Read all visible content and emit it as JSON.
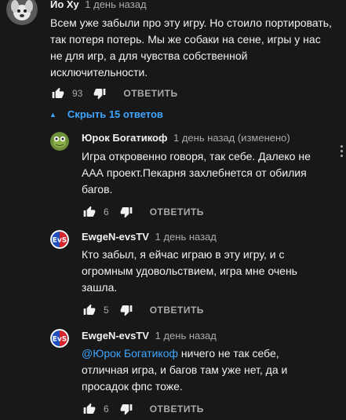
{
  "top_comment": {
    "author": "Йо Ху",
    "time": "1 день назад",
    "text": "Всем уже забыли про эту игру. Но стоило портировать, так потеря потерь. Мы же собаки на сене, игры у нас не для игр, а для чувства собственной исключительности.",
    "likes": "93",
    "reply_label": "ОТВЕТИТЬ",
    "avatar_icon": "dog-avatar-icon"
  },
  "replies_toggle": {
    "label": "Скрыть 15 ответов",
    "icon": "caret-up-icon"
  },
  "replies": [
    {
      "author": "Юрок Богатикоф",
      "time": "1 день назад (изменено)",
      "text": "Игра откровенно говоря, так себе. Далеко не ААА проект.Пекарня захлебнется от обилия багов.",
      "likes": "6",
      "reply_label": "ОТВЕТИТЬ",
      "avatar_icon": "frog-avatar-icon"
    },
    {
      "author": "EwgeN-evsTV",
      "time": "1 день назад",
      "text": "Кто забыл, я ейчас играю в эту игру,  и  с огромным удовольствием,  игра мне очень зашла.",
      "likes": "5",
      "reply_label": "ОТВЕТИТЬ",
      "avatar_icon": "evs-logo-avatar-icon"
    },
    {
      "author": "EwgeN-evsTV",
      "time": "1 день назад",
      "mention": "@Юрок Богатикоф",
      "text": " ничего не так себе, отличная игра,  и багов там уже нет,  да и просадок фпс тоже.",
      "likes": "6",
      "reply_label": "ОТВЕТИТЬ",
      "avatar_icon": "evs-logo-avatar-icon"
    }
  ],
  "colors": {
    "background": "#181818",
    "text": "#f1f1f1",
    "secondary": "#aaaaaa",
    "link": "#3ea6ff"
  }
}
